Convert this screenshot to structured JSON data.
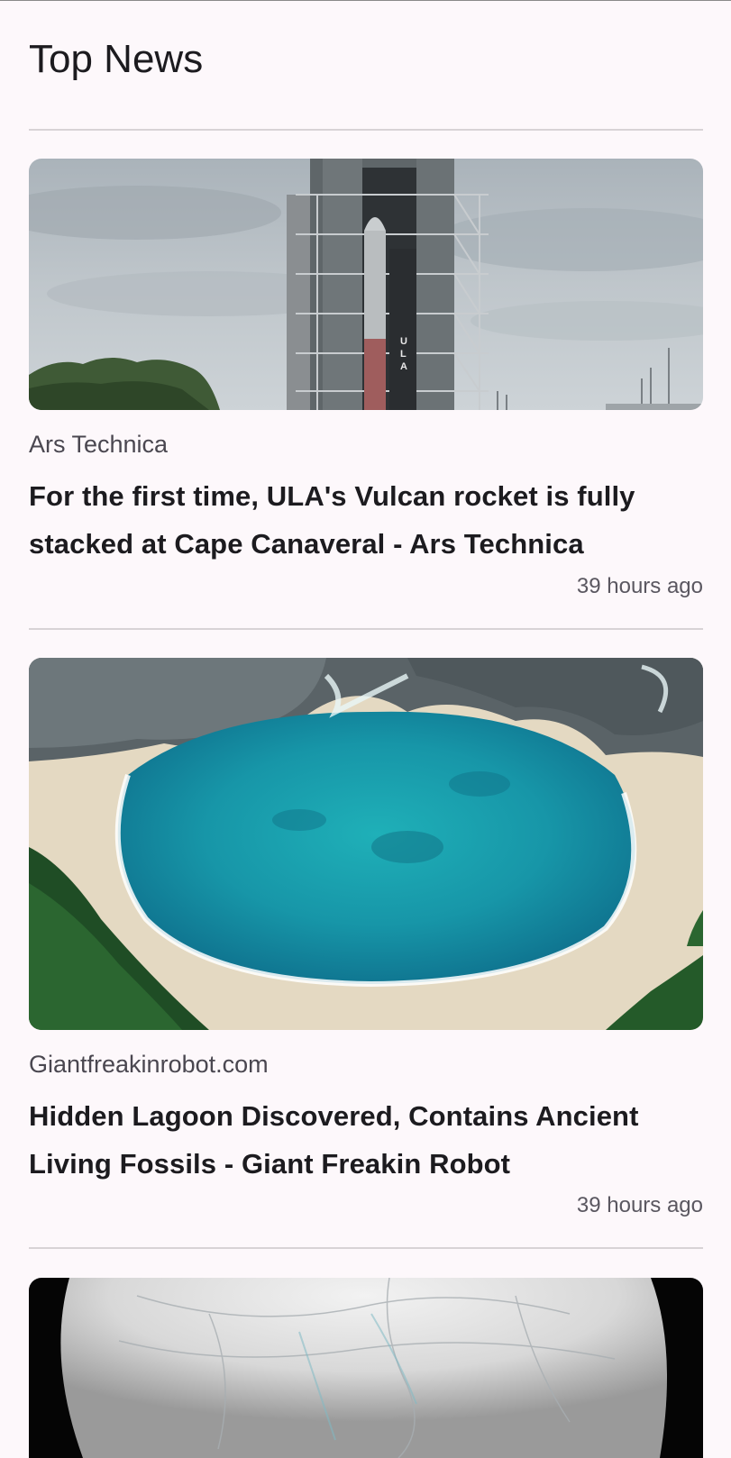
{
  "header": {
    "title": "Top News"
  },
  "articles": [
    {
      "source": "Ars Technica",
      "headline": "For the first time, ULA's Vulcan rocket is fully stacked at Cape Canaveral - Ars Technica",
      "time": "39 hours ago",
      "image": "rocket-launch-tower-image",
      "image_text": "ULA"
    },
    {
      "source": "Giantfreakinrobot.com",
      "headline": "Hidden Lagoon Discovered, Contains Ancient Living Fossils - Giant Freakin Robot",
      "time": "39 hours ago",
      "image": "lagoon-aerial-image"
    },
    {
      "image": "icy-moon-image"
    }
  ],
  "colors": {
    "background": "#fdf8fb",
    "divider": "#d8d3d6",
    "text_primary": "#1c1b1f",
    "text_secondary": "#4a4750"
  }
}
